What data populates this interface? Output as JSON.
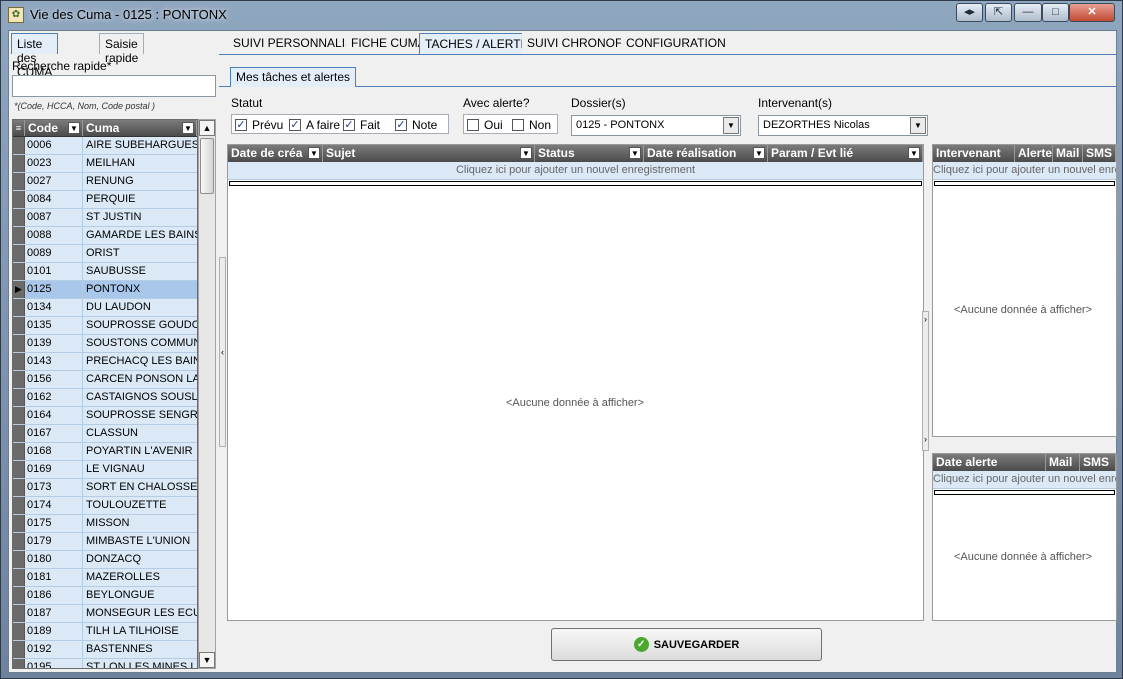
{
  "window": {
    "title": "Vie des Cuma - 0125 : PONTONX",
    "app_icon": "cuma-app-icon",
    "controls": [
      "◂▸",
      "⇱",
      "—",
      "□",
      "✕"
    ]
  },
  "left_panel": {
    "tabs": [
      {
        "label": "Liste des CUMA",
        "active": true
      },
      {
        "label": "Saisie rapide",
        "active": false
      }
    ],
    "search_label": "Recherche rapide*",
    "search_value": "",
    "search_hint": "*(Code, HCCA, Nom, Code postal )",
    "grid": {
      "columns": [
        "Code",
        "Cuma"
      ],
      "rows": [
        {
          "code": "0006",
          "cuma": "AIRE SUBEHARGUES"
        },
        {
          "code": "0023",
          "cuma": "MEILHAN"
        },
        {
          "code": "0027",
          "cuma": "RENUNG"
        },
        {
          "code": "0084",
          "cuma": "PERQUIE"
        },
        {
          "code": "0087",
          "cuma": "ST JUSTIN"
        },
        {
          "code": "0088",
          "cuma": "GAMARDE LES BAINS"
        },
        {
          "code": "0089",
          "cuma": "ORIST"
        },
        {
          "code": "0101",
          "cuma": "SAUBUSSE"
        },
        {
          "code": "0125",
          "cuma": "PONTONX",
          "selected": true
        },
        {
          "code": "0134",
          "cuma": "DU LAUDON"
        },
        {
          "code": "0135",
          "cuma": "SOUPROSSE GOUDOSS"
        },
        {
          "code": "0139",
          "cuma": "SOUSTONS COMMUNA"
        },
        {
          "code": "0143",
          "cuma": "PRECHACQ LES BAINS"
        },
        {
          "code": "0156",
          "cuma": "CARCEN PONSON LA M"
        },
        {
          "code": "0162",
          "cuma": "CASTAIGNOS SOUSLEN"
        },
        {
          "code": "0164",
          "cuma": "SOUPROSSE SENGRES"
        },
        {
          "code": "0167",
          "cuma": "CLASSUN"
        },
        {
          "code": "0168",
          "cuma": "POYARTIN L'AVENIR"
        },
        {
          "code": "0169",
          "cuma": "LE VIGNAU"
        },
        {
          "code": "0173",
          "cuma": "SORT EN CHALOSSE"
        },
        {
          "code": "0174",
          "cuma": "TOULOUZETTE"
        },
        {
          "code": "0175",
          "cuma": "MISSON"
        },
        {
          "code": "0179",
          "cuma": "MIMBASTE L'UNION"
        },
        {
          "code": "0180",
          "cuma": "DONZACQ"
        },
        {
          "code": "0181",
          "cuma": "MAZEROLLES"
        },
        {
          "code": "0186",
          "cuma": "BEYLONGUE"
        },
        {
          "code": "0187",
          "cuma": "MONSEGUR LES ECURE"
        },
        {
          "code": "0189",
          "cuma": "TILH LA TILHOISE"
        },
        {
          "code": "0192",
          "cuma": "BASTENNES"
        },
        {
          "code": "0195",
          "cuma": "ST LON LES MINES LA L"
        }
      ]
    }
  },
  "main": {
    "tabs": [
      {
        "label": "SUIVI PERSONNALISE",
        "active": false
      },
      {
        "label": "FICHE CUMA",
        "active": false
      },
      {
        "label": "TACHES / ALERTES",
        "active": true
      },
      {
        "label": "SUIVI CHRONOFD",
        "active": false
      },
      {
        "label": "CONFIGURATION",
        "active": false
      }
    ],
    "subtab": "Mes tâches et alertes",
    "filters": {
      "statut_label": "Statut",
      "statut_options": [
        {
          "label": "Prévu",
          "checked": true
        },
        {
          "label": "A faire",
          "checked": true
        },
        {
          "label": "Fait",
          "checked": true
        },
        {
          "label": "Note",
          "checked": true
        }
      ],
      "alerte_label": "Avec alerte?",
      "alerte_options": [
        {
          "label": "Oui",
          "checked": false
        },
        {
          "label": "Non",
          "checked": false
        }
      ],
      "dossier_label": "Dossier(s)",
      "dossier_value": "0125 - PONTONX",
      "intervenant_label": "Intervenant(s)",
      "intervenant_value": "DEZORTHES Nicolas"
    },
    "tasks_table": {
      "columns": [
        "Date de créa",
        "Sujet",
        "Status",
        "Date réalisation",
        "Param / Evt lié"
      ],
      "add_row_text": "Cliquez ici pour ajouter un nouvel enregistrement",
      "empty_text": "<Aucune donnée à afficher>"
    },
    "intervenant_table": {
      "columns": [
        "Intervenant",
        "Alerte",
        "Mail",
        "SMS"
      ],
      "add_row_text": "Cliquez ici pour ajouter un nouvel enregistrement",
      "empty_text": "<Aucune donnée à afficher>"
    },
    "alert_table": {
      "columns": [
        "Date alerte",
        "Mail",
        "SMS"
      ],
      "add_row_text": "Cliquez ici pour ajouter un nouvel enregistrement",
      "empty_text": "<Aucune donnée à afficher>"
    },
    "save_button": "SAUVEGARDER"
  }
}
